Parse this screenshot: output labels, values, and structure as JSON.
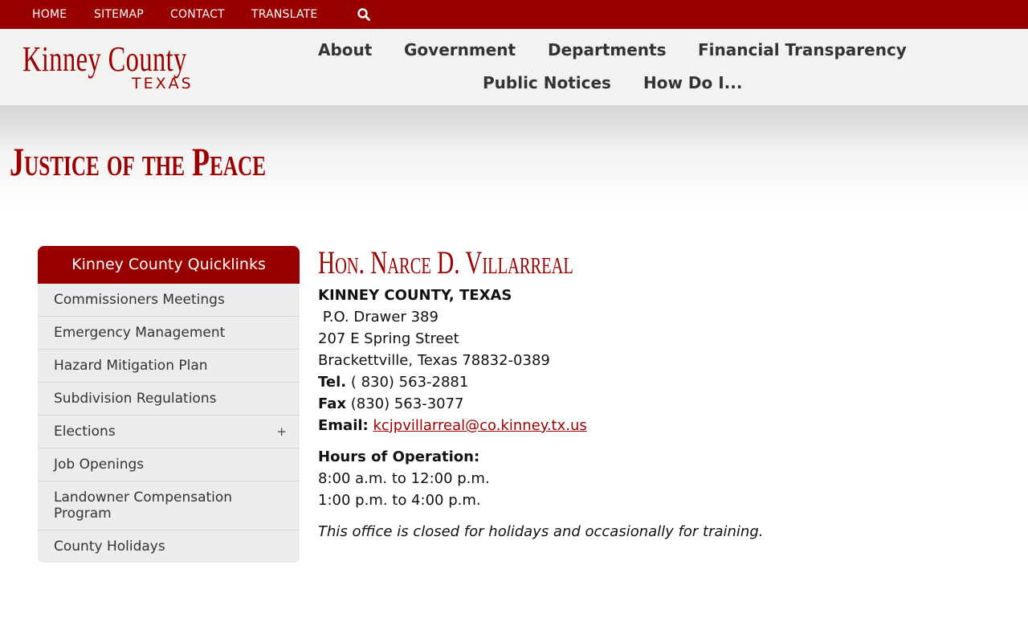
{
  "topbar": {
    "links": [
      "HOME",
      "SITEMAP",
      "CONTACT",
      "TRANSLATE"
    ],
    "search_icon": "search-icon"
  },
  "header": {
    "logo_main": "Kinney County",
    "logo_sub": "TEXAS",
    "nav": [
      "About",
      "Government",
      "Departments",
      "Financial Transparency",
      "Public Notices",
      "How Do I..."
    ]
  },
  "page": {
    "title": "Justice of the Peace"
  },
  "sidebar": {
    "title": "Kinney County Quicklinks",
    "items": [
      {
        "label": "Commissioners Meetings"
      },
      {
        "label": "Emergency Management"
      },
      {
        "label": "Hazard Mitigation Plan"
      },
      {
        "label": "Subdivision Regulations"
      },
      {
        "label": "Elections",
        "expand": "+"
      },
      {
        "label": "Job Openings"
      },
      {
        "label": "Landowner Compensation Program"
      },
      {
        "label": "County Holidays"
      }
    ]
  },
  "main": {
    "name": "Hon. Narce D. Villarreal",
    "county": "KINNEY COUNTY, TEXAS",
    "po_box": " P.O. Drawer 389",
    "street": "207 E Spring Street",
    "city": "Brackettville, Texas 78832-0389",
    "tel_label": "Tel.",
    "tel_value": " ( 830) 563-2881",
    "fax_label": "Fax",
    "fax_value": " (830) 563-3077",
    "email_label": "Email:",
    "email_value": "kcjpvillarreal@co.kinney.tx.us",
    "hours_label": "Hours of Operation:",
    "hours": [
      "8:00 a.m. to 12:00 p.m.",
      "1:00 p.m. to 4:00 p.m."
    ],
    "note": "This office is closed for holidays and occasionally for training."
  },
  "colors": {
    "brand": "#990000",
    "header_bg": "#f2f2f0",
    "sidebar_bg": "#ececec"
  }
}
